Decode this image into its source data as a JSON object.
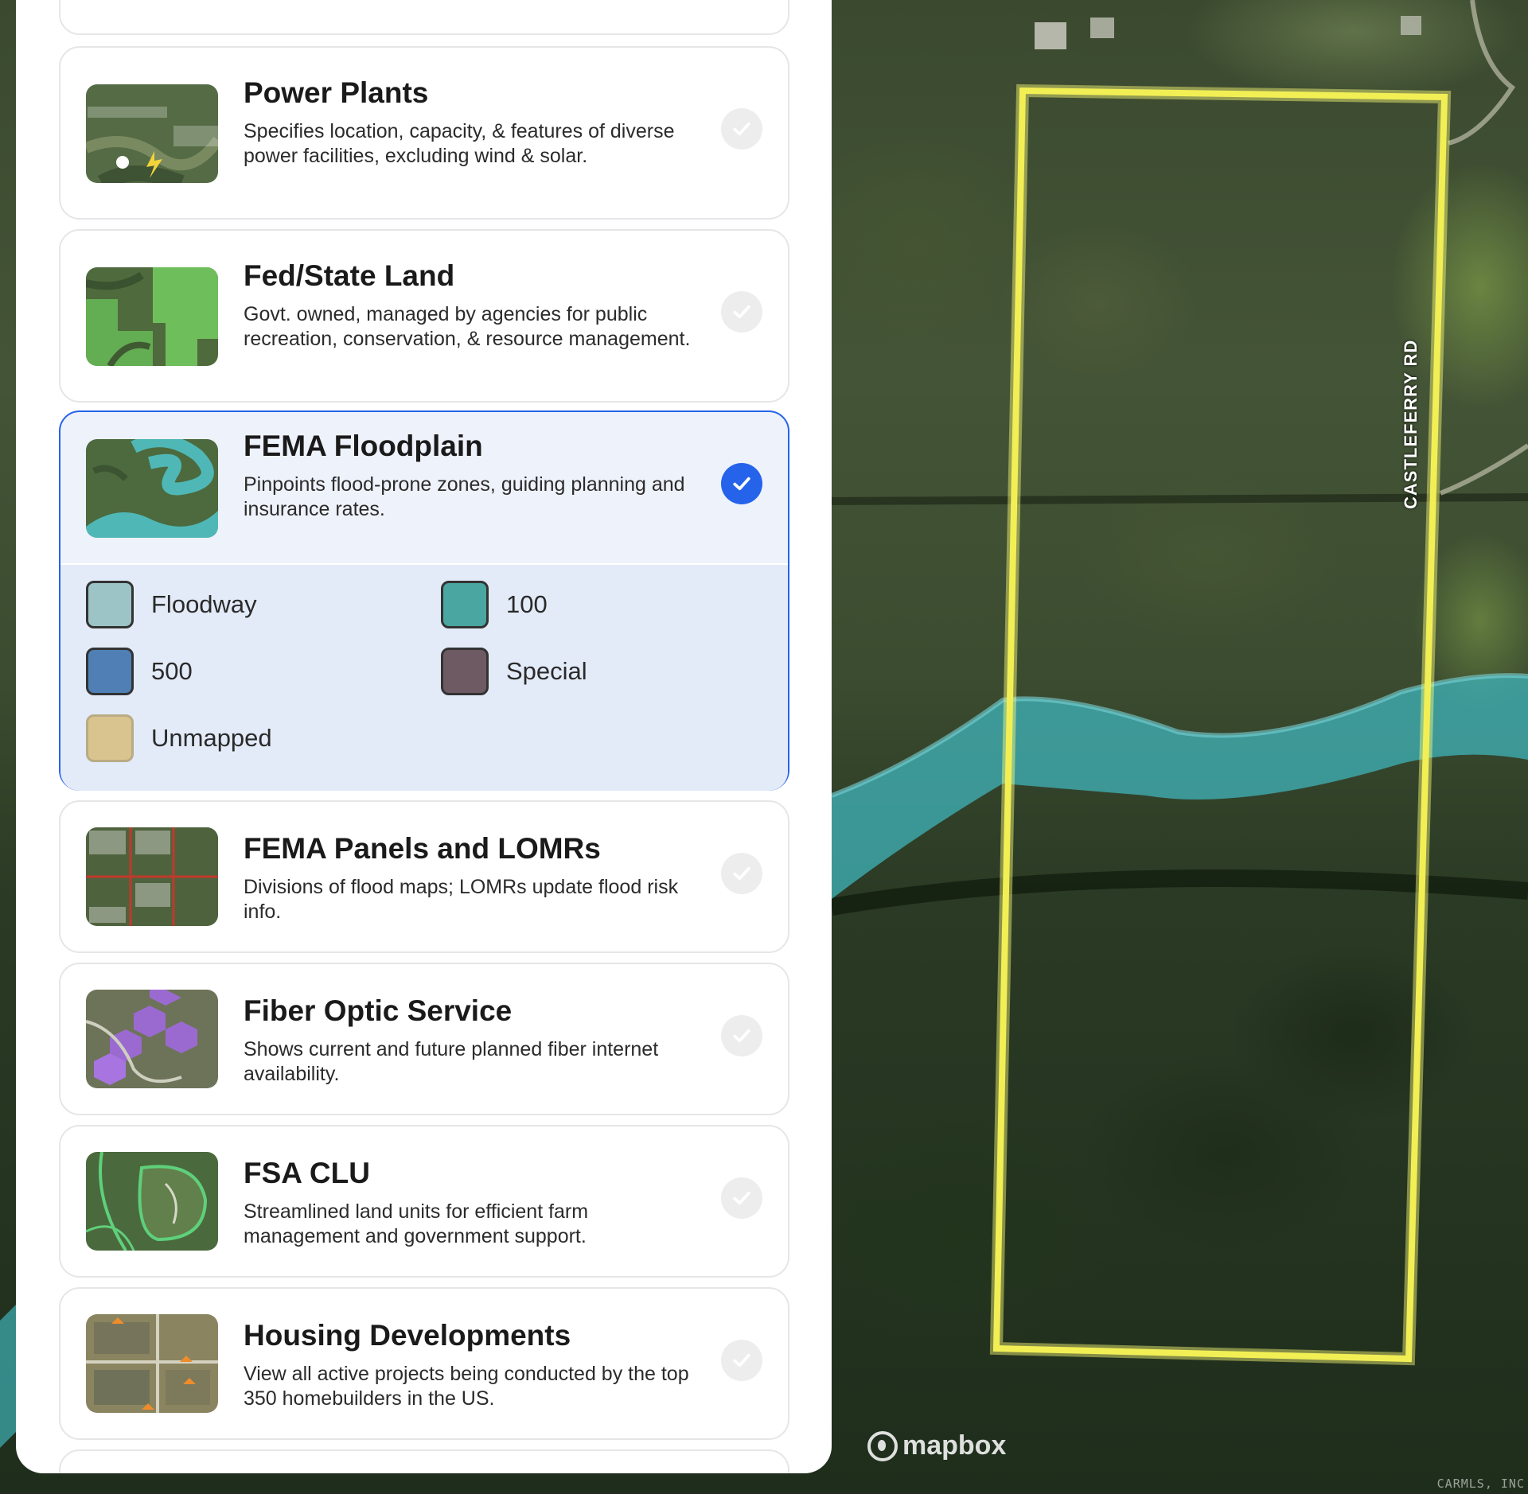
{
  "layers": [
    {
      "title": "Power Plants",
      "description": "Specifies location, capacity, & features of diverse power facilities, excluding wind & solar.",
      "selected": false,
      "thumb_icon": "power-plants-thumbnail-icon"
    },
    {
      "title": "Fed/State Land",
      "description": "Govt. owned, managed by agencies for public recreation, conservation, & resource management.",
      "selected": false,
      "thumb_icon": "fed-state-land-thumbnail-icon"
    },
    {
      "title": "FEMA Floodplain",
      "description": "Pinpoints flood-prone zones, guiding planning and insurance rates.",
      "selected": true,
      "thumb_icon": "fema-floodplain-thumbnail-icon"
    },
    {
      "title": "FEMA Panels and LOMRs",
      "description": "Divisions of flood maps; LOMRs update flood risk info.",
      "selected": false,
      "thumb_icon": "fema-panels-thumbnail-icon"
    },
    {
      "title": "Fiber Optic Service",
      "description": "Shows current and future planned fiber internet availability.",
      "selected": false,
      "thumb_icon": "fiber-optic-thumbnail-icon"
    },
    {
      "title": "FSA CLU",
      "description": "Streamlined land units for efficient farm management and government support.",
      "selected": false,
      "thumb_icon": "fsa-clu-thumbnail-icon"
    },
    {
      "title": "Housing Developments",
      "description": "View all active projects being conducted by the top 350 homebuilders in the US.",
      "selected": false,
      "thumb_icon": "housing-developments-thumbnail-icon"
    }
  ],
  "floodplain_legend": [
    {
      "label": "Floodway",
      "color": "#9cc3c6"
    },
    {
      "label": "100",
      "color": "#4aa6a1"
    },
    {
      "label": "500",
      "color": "#4f7fb5"
    },
    {
      "label": "Special",
      "color": "#6e5a63"
    },
    {
      "label": "Unmapped",
      "color": "#d9c38f"
    }
  ],
  "map": {
    "road_label": "CASTLEFERRY RD",
    "attribution_logo": "mapbox",
    "copyright": "CARMLS, INC",
    "parcel_outline_color": "#e8e23a",
    "flood_zone_color": "#3fb0b5"
  },
  "colors": {
    "accent": "#2563eb",
    "card_border": "#e6e6e9"
  }
}
